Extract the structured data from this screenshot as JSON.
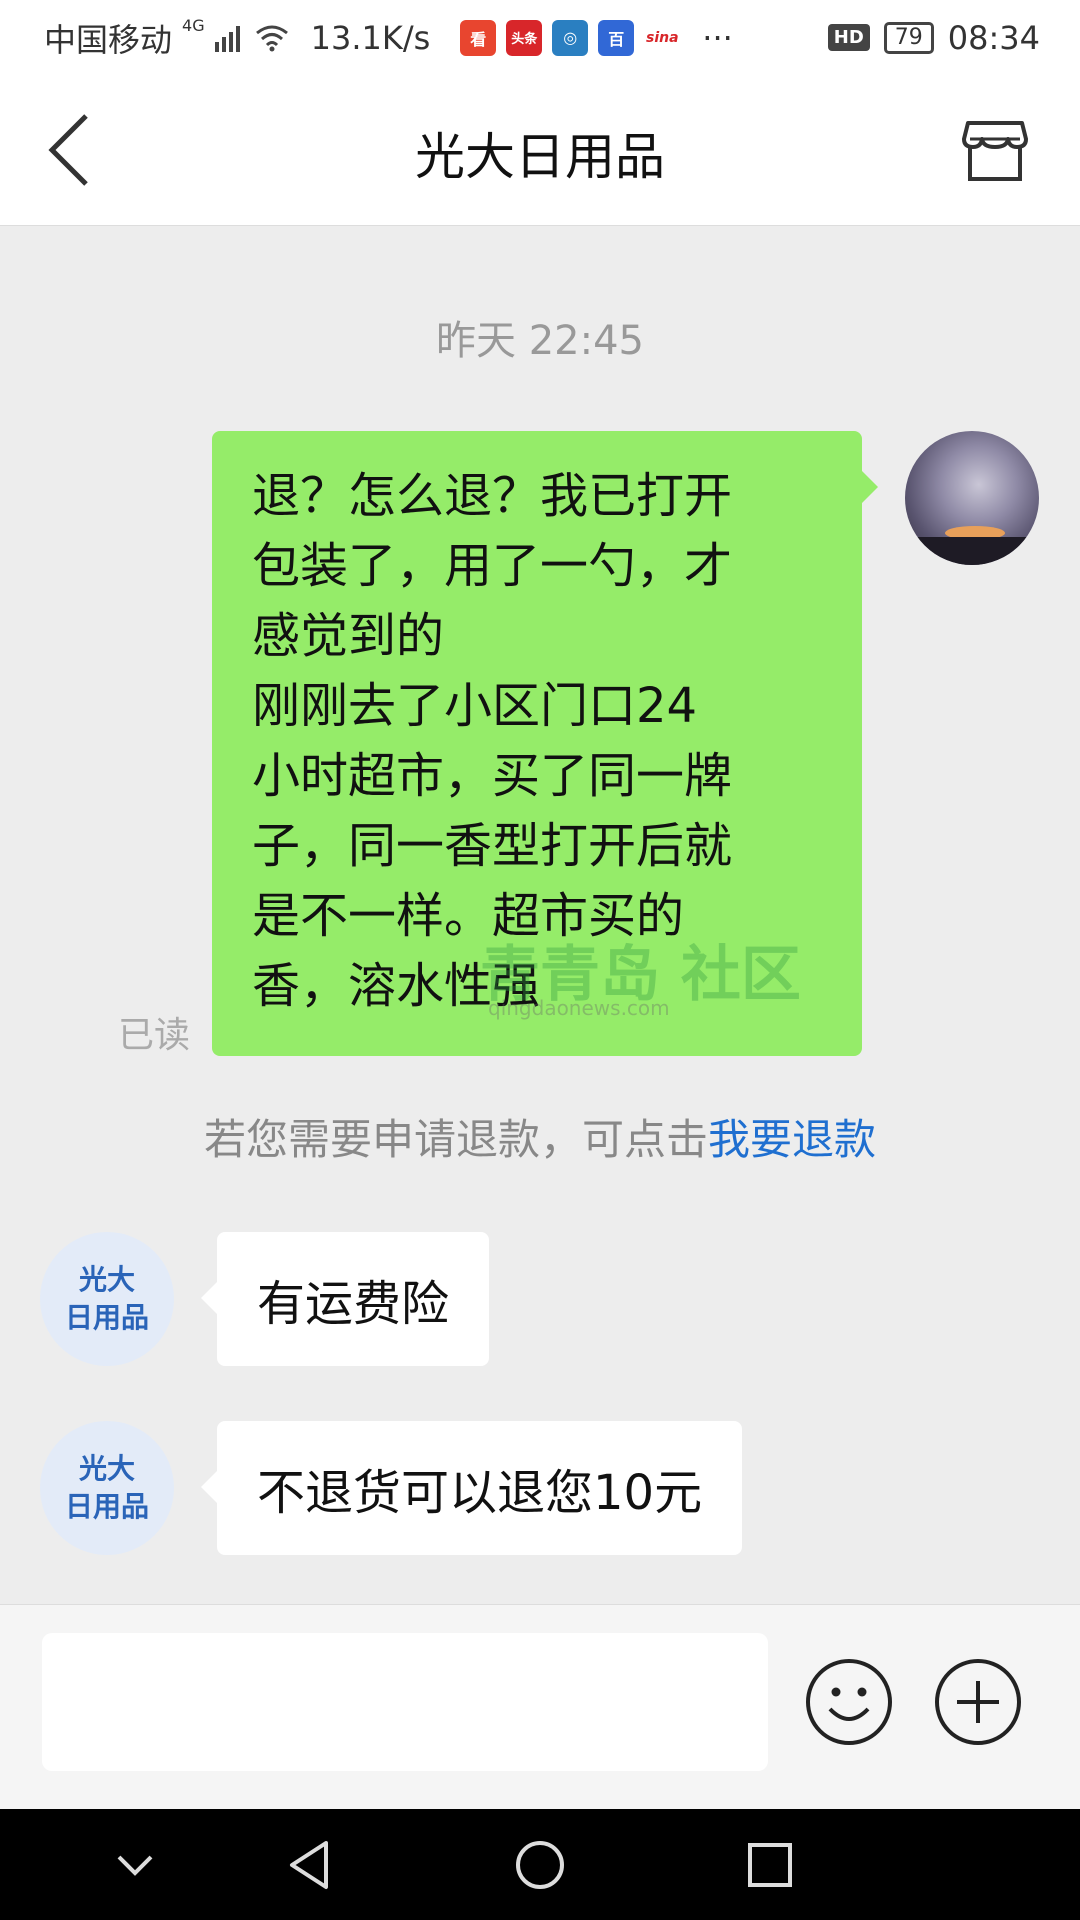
{
  "status_bar": {
    "carrier": "中国移动",
    "network": "4G",
    "speed": "13.1K/s",
    "hd": "HD",
    "battery": "79",
    "time": "08:34",
    "more": "···",
    "app_icons": [
      "看",
      "头条",
      "◎",
      "百",
      "sina"
    ]
  },
  "header": {
    "title": "光大日用品"
  },
  "chat": {
    "timestamp": "昨天 22:45",
    "my_message_lines": [
      "退？怎么退？我已打开",
      "包装了，用了一勺，才",
      "感觉到的",
      "刚刚去了小区门口24",
      "小时超市，买了同一牌",
      "子，同一香型打开后就",
      "是不一样。超市买的",
      "香，溶水性强"
    ],
    "read_label": "已读",
    "watermark": "青青岛 社区",
    "watermark_url": "qingdaonews.com",
    "refund_notice_prefix": "若您需要申请退款，可点击",
    "refund_link": "我要退款",
    "shop_avatar_line1": "光大",
    "shop_avatar_line2": "日用品",
    "shop_messages": [
      "有运费险",
      "不退货可以退您10元"
    ]
  },
  "colors": {
    "my_bubble": "#95ec69",
    "link": "#1f6fd0",
    "chat_background": "#ededed"
  }
}
